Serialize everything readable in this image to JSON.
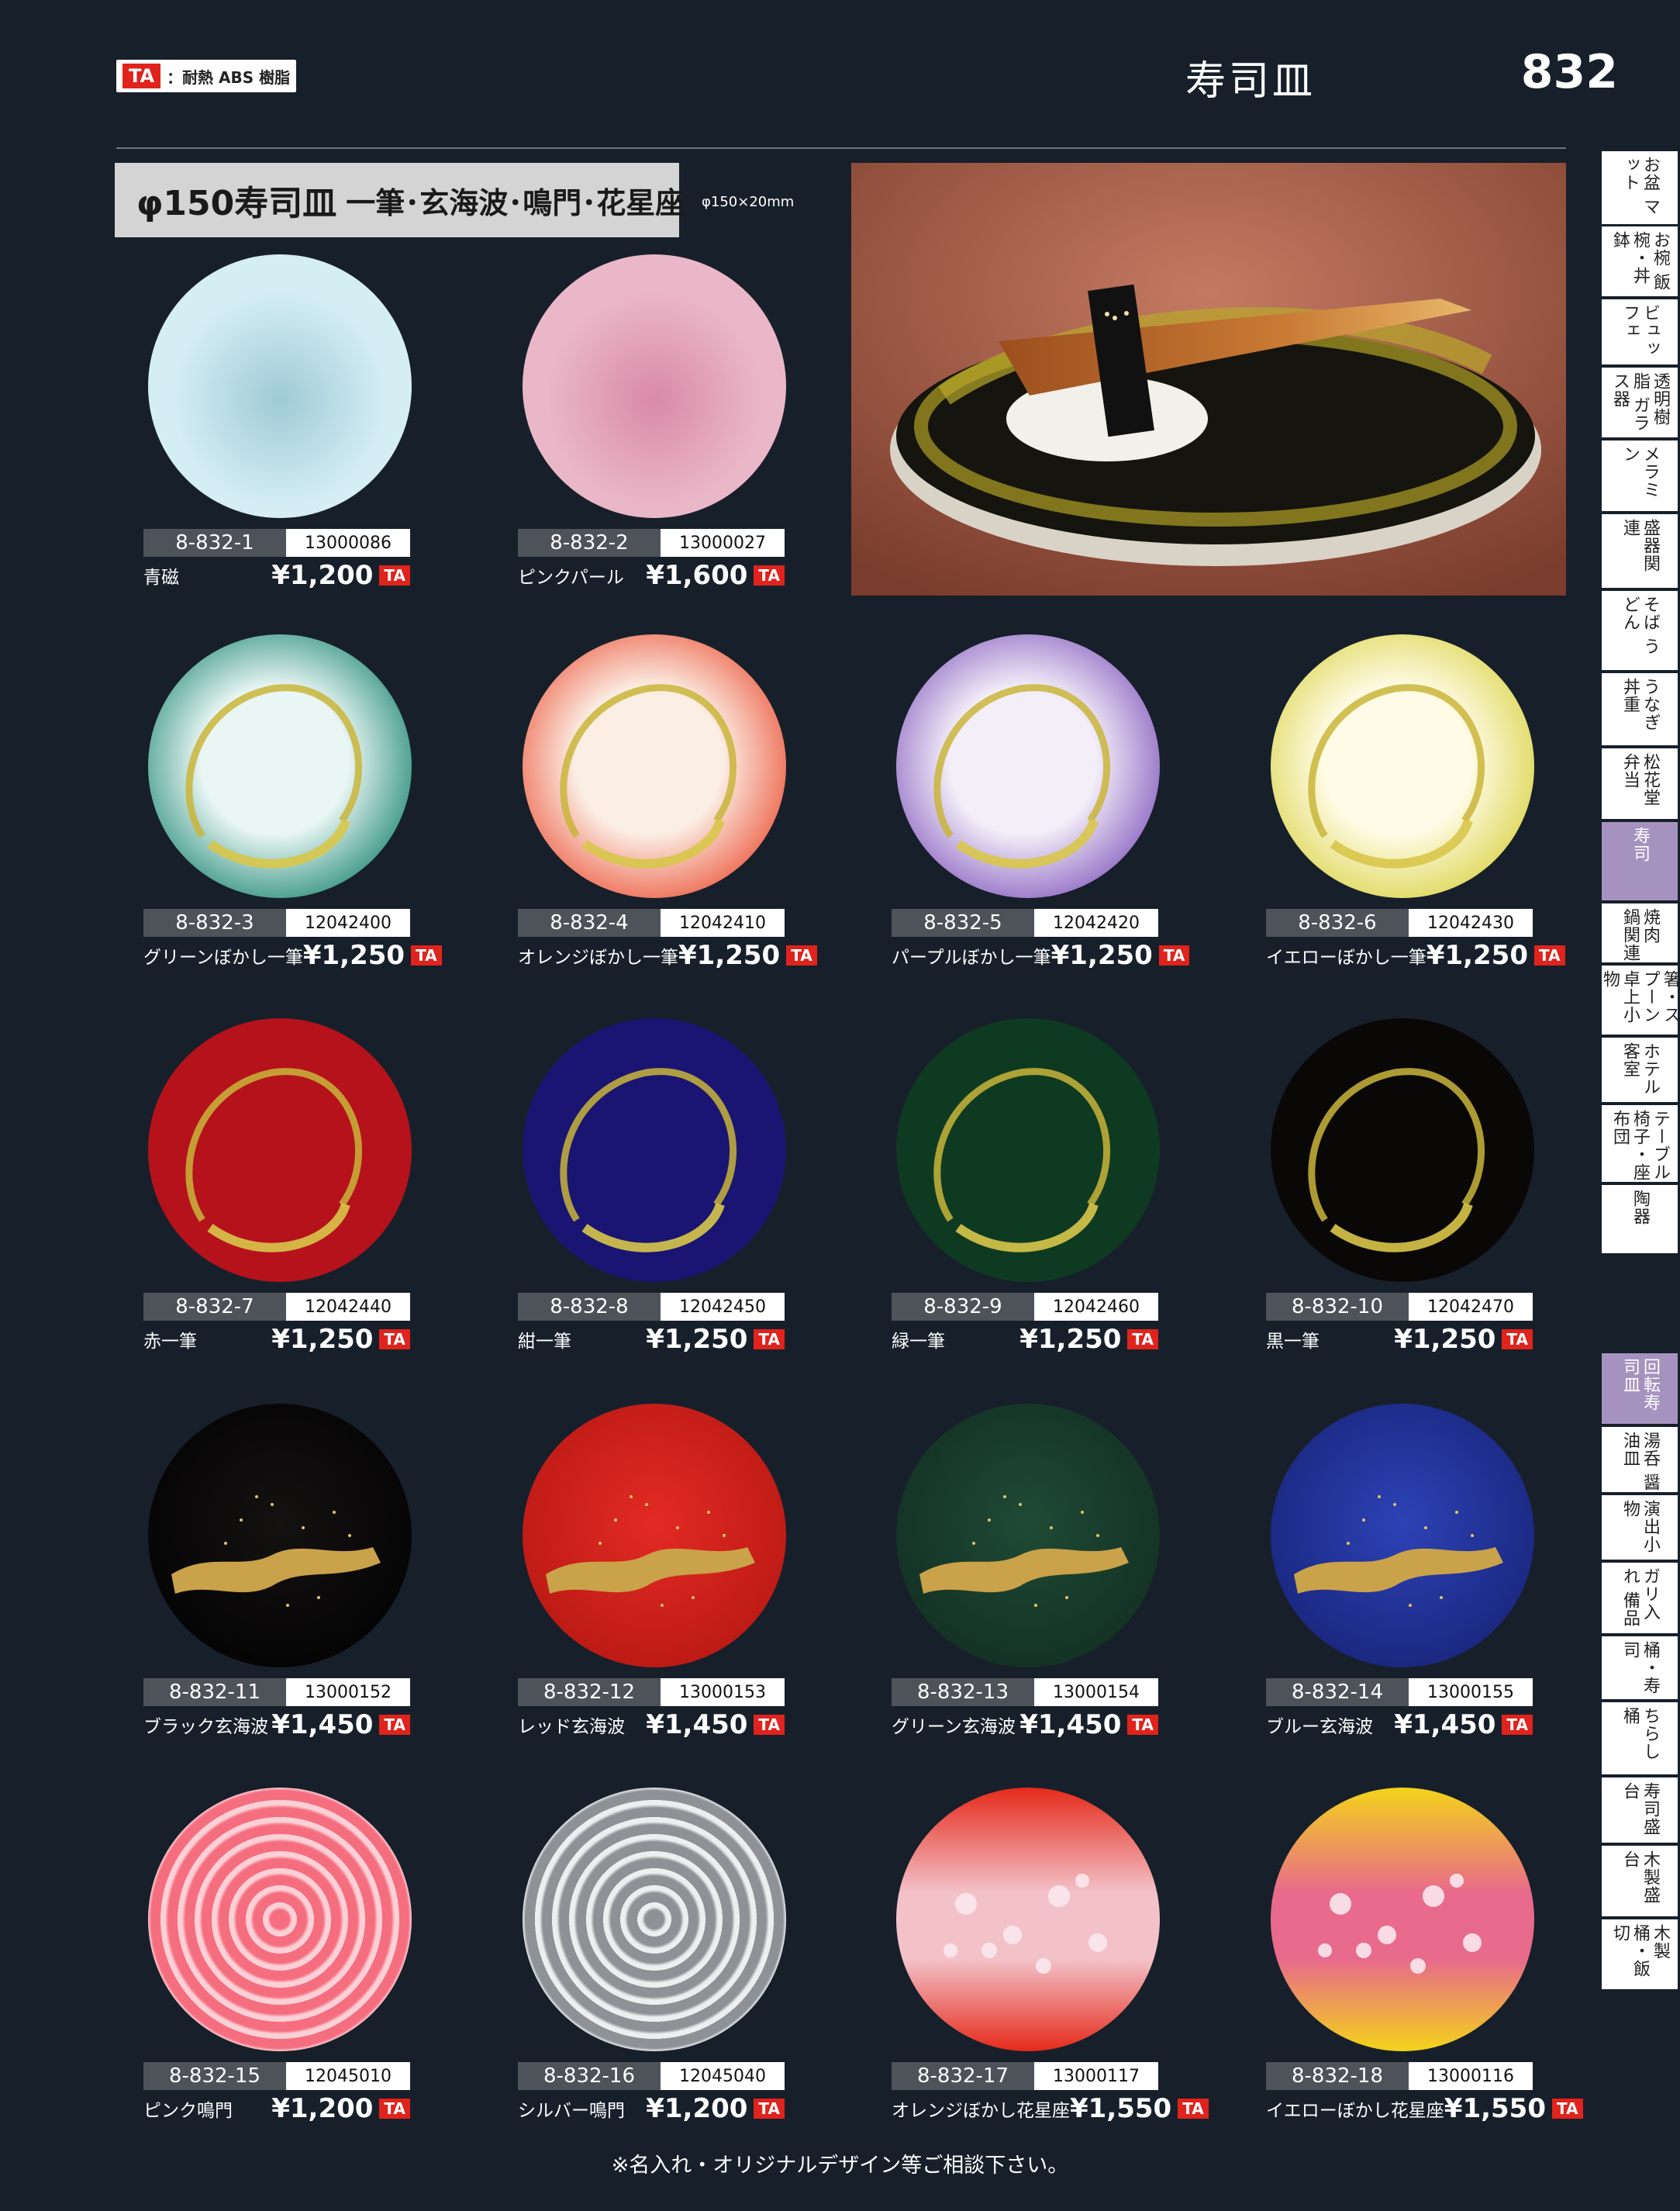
{
  "header": {
    "ta_badge": "TA",
    "ta_legend": "：耐熱 ABS 樹脂",
    "title": "寿司皿",
    "page_number": "832"
  },
  "section": {
    "title_main": "φ150寿司皿",
    "title_sub": "一筆･玄海波･鳴門･花星座",
    "size_note": "φ150×20mm"
  },
  "products": [
    {
      "code": "8-832-1",
      "jan": "13000086",
      "name": "青磁",
      "price": "¥1,200",
      "material": "TA",
      "style": "plain",
      "c1": "#d4eef4",
      "c2": "#9fcad6"
    },
    {
      "code": "8-832-2",
      "jan": "13000027",
      "name": "ピンクパール",
      "price": "¥1,600",
      "material": "TA",
      "style": "plain",
      "c1": "#eab7c8",
      "c2": "#d98aa6"
    },
    {
      "code": "8-832-3",
      "jan": "12042400",
      "name": "グリーンぼかし一筆",
      "price": "¥1,250",
      "material": "TA",
      "style": "bokashi",
      "c1": "#e9f6f4",
      "c2": "#0f7e6a"
    },
    {
      "code": "8-832-4",
      "jan": "12042410",
      "name": "オレンジぼかし一筆",
      "price": "¥1,250",
      "material": "TA",
      "style": "bokashi",
      "c1": "#fbeee5",
      "c2": "#ea4a2d"
    },
    {
      "code": "8-832-5",
      "jan": "12042420",
      "name": "パープルぼかし一筆",
      "price": "¥1,250",
      "material": "TA",
      "style": "bokashi",
      "c1": "#f3eef8",
      "c2": "#7b4fb9"
    },
    {
      "code": "8-832-6",
      "jan": "12042430",
      "name": "イエローぼかし一筆",
      "price": "¥1,250",
      "material": "TA",
      "style": "bokashi",
      "c1": "#fffbe6",
      "c2": "#d7d03c"
    },
    {
      "code": "8-832-7",
      "jan": "12042440",
      "name": "赤一筆",
      "price": "¥1,250",
      "material": "TA",
      "style": "fude",
      "c1": "#b5121b",
      "c2": "#8e0c12"
    },
    {
      "code": "8-832-8",
      "jan": "12042450",
      "name": "紺一筆",
      "price": "¥1,250",
      "material": "TA",
      "style": "fude",
      "c1": "#1a1572",
      "c2": "#0e0c4a"
    },
    {
      "code": "8-832-9",
      "jan": "12042460",
      "name": "緑一筆",
      "price": "¥1,250",
      "material": "TA",
      "style": "fude",
      "c1": "#0f3a22",
      "c2": "#082515"
    },
    {
      "code": "8-832-10",
      "jan": "12042470",
      "name": "黒一筆",
      "price": "¥1,250",
      "material": "TA",
      "style": "fude",
      "c1": "#0a0707",
      "c2": "#1e1713"
    },
    {
      "code": "8-832-11",
      "jan": "13000152",
      "name": "ブラック玄海波",
      "price": "¥1,450",
      "material": "TA",
      "style": "wave",
      "c1": "#141111",
      "c2": "#000000"
    },
    {
      "code": "8-832-12",
      "jan": "13000153",
      "name": "レッド玄海波",
      "price": "¥1,450",
      "material": "TA",
      "style": "wave",
      "c1": "#e32a24",
      "c2": "#b01510"
    },
    {
      "code": "8-832-13",
      "jan": "13000154",
      "name": "グリーン玄海波",
      "price": "¥1,450",
      "material": "TA",
      "style": "wave",
      "c1": "#1f4a36",
      "c2": "#102a1e"
    },
    {
      "code": "8-832-14",
      "jan": "13000155",
      "name": "ブルー玄海波",
      "price": "¥1,450",
      "material": "TA",
      "style": "wave",
      "c1": "#2d42b6",
      "c2": "#141f6e"
    },
    {
      "code": "8-832-15",
      "jan": "12045010",
      "name": "ピンク鳴門",
      "price": "¥1,200",
      "material": "TA",
      "style": "naruto",
      "c1": "#f56e7f",
      "c2": "#fbd0d6"
    },
    {
      "code": "8-832-16",
      "jan": "12045040",
      "name": "シルバー鳴門",
      "price": "¥1,200",
      "material": "TA",
      "style": "naruto",
      "c1": "#8e9297",
      "c2": "#eceef0"
    },
    {
      "code": "8-832-17",
      "jan": "13000117",
      "name": "オレンジぼかし花星座",
      "price": "¥1,550",
      "material": "TA",
      "style": "hana",
      "c1": "#e52a1a",
      "c2": "#f3c2c9"
    },
    {
      "code": "8-832-18",
      "jan": "13000116",
      "name": "イエローぼかし花星座",
      "price": "¥1,550",
      "material": "TA",
      "style": "hana",
      "c1": "#f3d31a",
      "c2": "#e86a8c"
    }
  ],
  "side_tabs": [
    {
      "label": "お盆 マット",
      "active": false
    },
    {
      "label": "お椀 飯椀・丼鉢",
      "active": false
    },
    {
      "label": "ビュッフェ",
      "active": false
    },
    {
      "label": "透明樹脂 ガラス器",
      "active": false
    },
    {
      "label": "メラミン",
      "active": false
    },
    {
      "label": "盛器関連",
      "active": false
    },
    {
      "label": "そば うどん",
      "active": false
    },
    {
      "label": "うなぎ 丼重",
      "active": false
    },
    {
      "label": "松花堂 弁当",
      "active": false
    },
    {
      "label": "寿司",
      "active": true
    },
    {
      "label": "焼肉 鍋関連",
      "active": false
    },
    {
      "label": "箸・スプーン 卓上小物",
      "active": false
    },
    {
      "label": "ホテル 客室",
      "active": false
    },
    {
      "label": "テーブル 椅子・座布団",
      "active": false
    },
    {
      "label": "陶器",
      "active": false
    },
    {
      "label": "回転寿司皿",
      "active": true
    },
    {
      "label": "湯呑 醤油皿",
      "active": false
    },
    {
      "label": "演出小物",
      "active": false
    },
    {
      "label": "ガリ入れ 備品",
      "active": false
    },
    {
      "label": "桶・寿司",
      "active": false
    },
    {
      "label": "ちらし桶",
      "active": false
    },
    {
      "label": "寿司盛台",
      "active": false
    },
    {
      "label": "木製盛台",
      "active": false
    },
    {
      "label": "木製 桶・飯切",
      "active": false
    }
  ],
  "footer": "※名入れ・オリジナルデザイン等ご相談下さい。"
}
